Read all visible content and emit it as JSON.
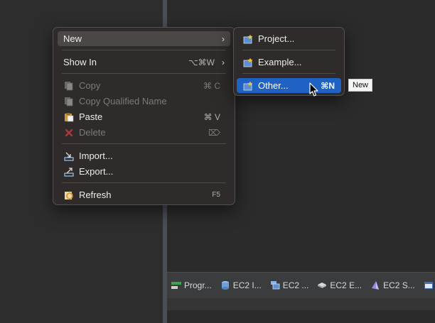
{
  "context_menu": {
    "items": [
      {
        "label": "New",
        "arrow": "›"
      },
      {
        "label": "Show In",
        "shortcut": "⌥⌘W",
        "arrow": "›"
      },
      {
        "label": "Copy",
        "shortcut": "⌘ C"
      },
      {
        "label": "Copy Qualified Name"
      },
      {
        "label": "Paste",
        "shortcut": "⌘ V"
      },
      {
        "label": "Delete",
        "shortcut": "⌦"
      },
      {
        "label": "Import..."
      },
      {
        "label": "Export..."
      },
      {
        "label": "Refresh",
        "shortcut": "F5"
      }
    ]
  },
  "submenu": {
    "items": [
      {
        "label": "Project..."
      },
      {
        "label": "Example..."
      },
      {
        "label": "Other...",
        "shortcut": "⌘N"
      }
    ]
  },
  "tooltip": {
    "text": "New"
  },
  "bottom_tabs": [
    {
      "label": "Progr..."
    },
    {
      "label": "EC2 I..."
    },
    {
      "label": "EC2 ..."
    },
    {
      "label": "EC2 E..."
    },
    {
      "label": "EC2 S..."
    }
  ],
  "colors": {
    "selection": "#1f62c4",
    "menu_bg": "#2f2b2b",
    "highlight": "#4b4747"
  }
}
